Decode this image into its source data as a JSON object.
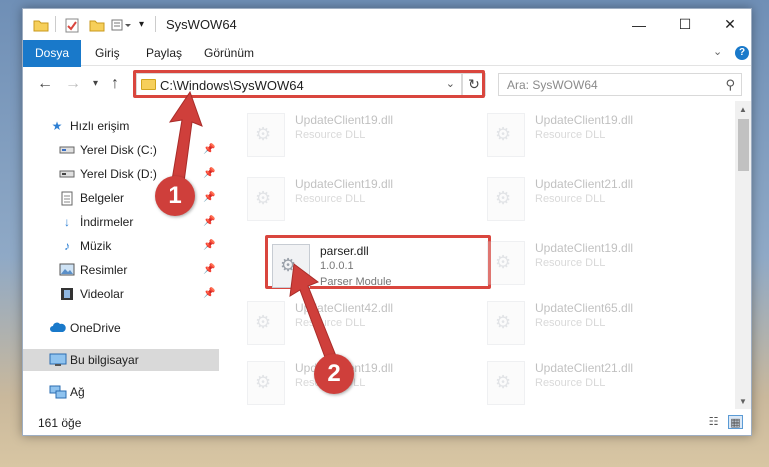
{
  "window": {
    "title": "SysWOW64"
  },
  "ribbon": {
    "tabs": [
      {
        "label": "Dosya"
      },
      {
        "label": "Giriş"
      },
      {
        "label": "Paylaş"
      },
      {
        "label": "Görünüm"
      }
    ]
  },
  "address": {
    "path": "C:\\Windows\\SysWOW64"
  },
  "search": {
    "placeholder": "Ara: SysWOW64"
  },
  "sidebar": {
    "items": [
      {
        "label": "Hızlı erişim",
        "icon": "star-icon",
        "pinned": false
      },
      {
        "label": "Yerel Disk (C:)",
        "icon": "drive-icon",
        "pinned": true
      },
      {
        "label": "Yerel Disk (D:)",
        "icon": "drive-icon",
        "pinned": true
      },
      {
        "label": "Belgeler",
        "icon": "document-icon",
        "pinned": true
      },
      {
        "label": "İndirmeler",
        "icon": "download-icon",
        "pinned": true
      },
      {
        "label": "Müzik",
        "icon": "music-icon",
        "pinned": true
      },
      {
        "label": "Resimler",
        "icon": "picture-icon",
        "pinned": true
      },
      {
        "label": "Videolar",
        "icon": "video-icon",
        "pinned": true
      },
      {
        "label": "OneDrive",
        "icon": "cloud-icon",
        "pinned": false
      },
      {
        "label": "Bu bilgisayar",
        "icon": "computer-icon",
        "pinned": false
      },
      {
        "label": "Ağ",
        "icon": "network-icon",
        "pinned": false
      }
    ]
  },
  "files": [
    {
      "name": "UpdateClient19.dll",
      "desc": "Resource DLL",
      "desc2": ""
    },
    {
      "name": "UpdateClient19.dll",
      "desc": "Resource DLL",
      "desc2": ""
    },
    {
      "name": "UpdateClient19.dll",
      "desc": "Resource DLL",
      "desc2": ""
    },
    {
      "name": "UpdateClient21.dll",
      "desc": "Resource DLL",
      "desc2": ""
    },
    {
      "name": "parser.dll",
      "desc": "1.0.0.1",
      "desc2": "Parser Module"
    },
    {
      "name": "UpdateClient19.dll",
      "desc": "Resource DLL",
      "desc2": ""
    },
    {
      "name": "UpdateClient42.dll",
      "desc": "Resource DLL",
      "desc2": ""
    },
    {
      "name": "UpdateClient65.dll",
      "desc": "Resource DLL",
      "desc2": ""
    },
    {
      "name": "UpdateClient19.dll",
      "desc": "Resource DLL",
      "desc2": ""
    },
    {
      "name": "UpdateClient21.dll",
      "desc": "Resource DLL",
      "desc2": ""
    }
  ],
  "status": {
    "count": "161 öğe"
  },
  "annotations": {
    "step1": "1",
    "step2": "2",
    "color": "#cf3f3b"
  }
}
